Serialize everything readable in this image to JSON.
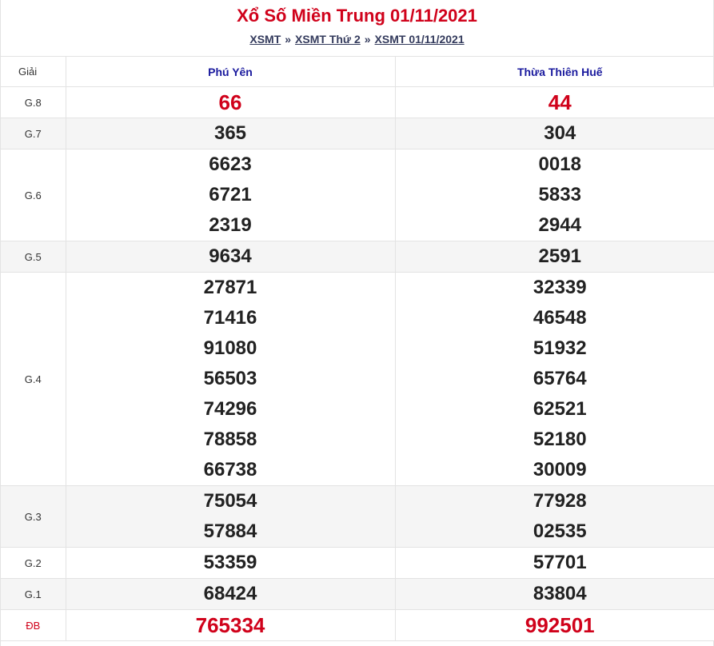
{
  "header": {
    "title": "Xổ Số Miền Trung 01/11/2021",
    "breadcrumb": [
      {
        "label": "XSMT"
      },
      {
        "label": "XSMT Thứ 2"
      },
      {
        "label": "XSMT 01/11/2021"
      }
    ],
    "separator": "»"
  },
  "table": {
    "col_label": "Giải",
    "provinces": [
      "Phú Yên",
      "Thừa Thiên Huế"
    ],
    "prizes": [
      {
        "label": "G.8",
        "row": "even",
        "style": "red-big",
        "values": [
          [
            "66"
          ],
          [
            "44"
          ]
        ]
      },
      {
        "label": "G.7",
        "row": "odd",
        "values": [
          [
            "365"
          ],
          [
            "304"
          ]
        ]
      },
      {
        "label": "G.6",
        "row": "even",
        "values": [
          [
            "6623",
            "6721",
            "2319"
          ],
          [
            "0018",
            "5833",
            "2944"
          ]
        ]
      },
      {
        "label": "G.5",
        "row": "odd",
        "values": [
          [
            "9634"
          ],
          [
            "2591"
          ]
        ]
      },
      {
        "label": "G.4",
        "row": "even",
        "values": [
          [
            "27871",
            "71416",
            "91080",
            "56503",
            "74296",
            "78858",
            "66738"
          ],
          [
            "32339",
            "46548",
            "51932",
            "65764",
            "62521",
            "52180",
            "30009"
          ]
        ]
      },
      {
        "label": "G.3",
        "row": "odd",
        "values": [
          [
            "75054",
            "57884"
          ],
          [
            "77928",
            "02535"
          ]
        ]
      },
      {
        "label": "G.2",
        "row": "even",
        "values": [
          [
            "53359"
          ],
          [
            "57701"
          ]
        ]
      },
      {
        "label": "G.1",
        "row": "odd",
        "values": [
          [
            "68424"
          ],
          [
            "83804"
          ]
        ]
      },
      {
        "label": "ĐB",
        "row": "even",
        "style": "red-big",
        "special": true,
        "values": [
          [
            "765334"
          ],
          [
            "992501"
          ]
        ]
      }
    ]
  },
  "colors": {
    "accent_red": "#d0021b",
    "province_blue": "#1a1a9e",
    "link": "#333a5c"
  }
}
